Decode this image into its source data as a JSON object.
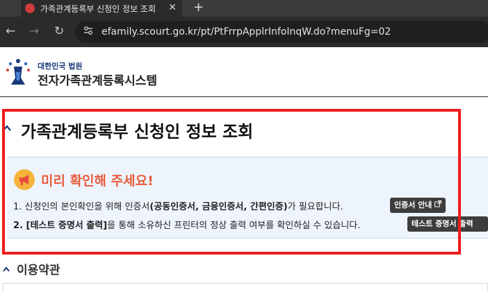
{
  "browser": {
    "tab_title": "가족관계등록부 신청인 정보 조회",
    "tab_close_glyph": "✕",
    "new_tab_glyph": "+",
    "back_glyph": "←",
    "forward_glyph": "→",
    "reload_glyph": "↻",
    "url": "efamily.scourt.go.kr/pt/PtFrrpApplrInfoInqW.do?menuFg=02"
  },
  "header": {
    "court_name": "대한민국 법원",
    "system_name": "전자가족관계등록시스템"
  },
  "main": {
    "title": "가족관계등록부 신청인 정보 조회",
    "notice": {
      "heading": "미리 확인해 주세요!",
      "line1_prefix": "1. 신청인의 본인확인을 위해 인증서",
      "line1_bold": "(공동인증서, 금융인증서, 간편인증)",
      "line1_suffix": "가 필요합니다.",
      "cert_button": "인증서 안내",
      "line2_bold": "2. [테스트 증명서 출력]",
      "line2_suffix": "을 통해 소유하신 프린터의 정상 출력 여부를 확인하실 수 있습니다.",
      "print_button": "테스트 증명서 출력"
    },
    "terms_title": "이용약관"
  },
  "colors": {
    "highlight": "#ee1c1c",
    "notice_heading": "#e85c3c",
    "notice_bg": "#eef4fc",
    "court_blue": "#1a3a7a"
  },
  "icons": [
    "site-favicon",
    "site-info-icon",
    "court-logo-icon",
    "megaphone-icon",
    "external-link-icon",
    "chevron-icon"
  ]
}
